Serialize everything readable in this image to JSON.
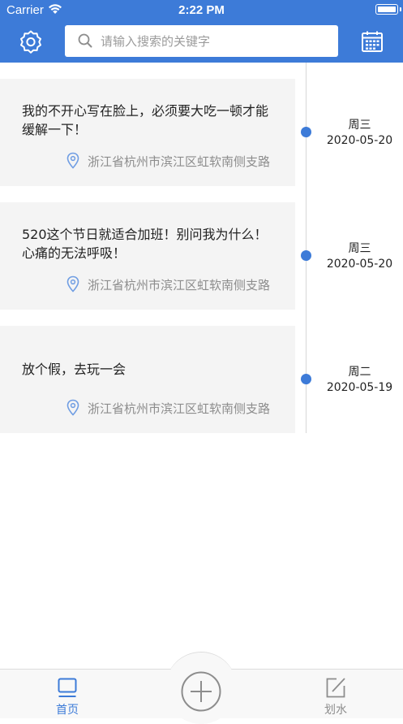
{
  "status_bar": {
    "carrier": "Carrier",
    "time": "2:22 PM"
  },
  "header": {
    "search_placeholder": "请输入搜索的关键字",
    "settings_icon": "gear-icon",
    "calendar_icon": "calendar-icon"
  },
  "entries": [
    {
      "text": "我的不开心写在脸上，必须要大吃一顿才能缓解一下！",
      "location": "浙江省杭州市滨江区虹软南侧支路",
      "weekday": "周三",
      "date": "2020-05-20"
    },
    {
      "text": "520这个节日就适合加班！别问我为什么！心痛的无法呼吸！",
      "location": "浙江省杭州市滨江区虹软南侧支路",
      "weekday": "周三",
      "date": "2020-05-20"
    },
    {
      "text": "放个假，去玩一会",
      "location": "浙江省杭州市滨江区虹软南侧支路",
      "weekday": "周二",
      "date": "2020-05-19"
    }
  ],
  "tab_bar": {
    "home_label": "首页",
    "slack_label": "划水",
    "active_tab": "首页"
  },
  "colors": {
    "accent": "#3d7bd8",
    "card_bg": "#f4f4f4",
    "secondary_text": "#8d8d8d"
  }
}
